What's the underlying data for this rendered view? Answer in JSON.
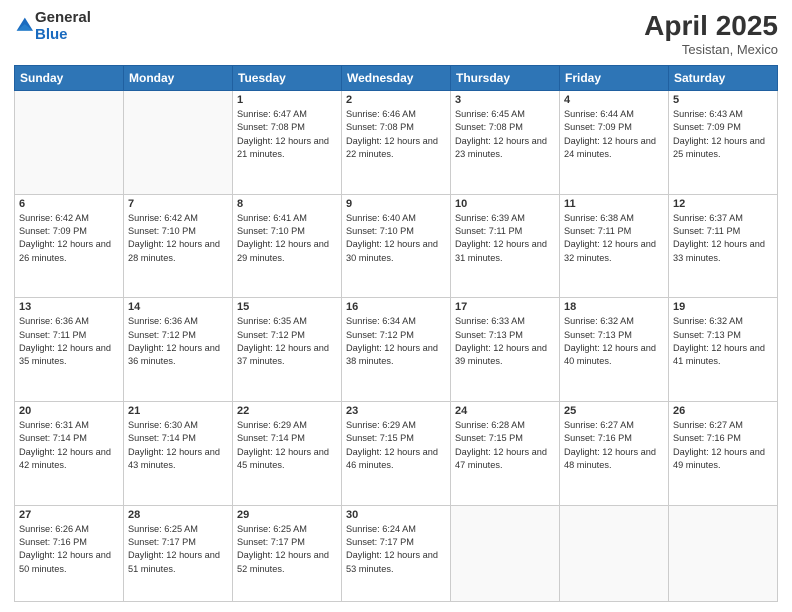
{
  "logo": {
    "line1": "General",
    "line2": "Blue"
  },
  "title": "April 2025",
  "subtitle": "Tesistan, Mexico",
  "days_header": [
    "Sunday",
    "Monday",
    "Tuesday",
    "Wednesday",
    "Thursday",
    "Friday",
    "Saturday"
  ],
  "weeks": [
    [
      {
        "day": "",
        "sunrise": "",
        "sunset": "",
        "daylight": ""
      },
      {
        "day": "",
        "sunrise": "",
        "sunset": "",
        "daylight": ""
      },
      {
        "day": "1",
        "sunrise": "Sunrise: 6:47 AM",
        "sunset": "Sunset: 7:08 PM",
        "daylight": "Daylight: 12 hours and 21 minutes."
      },
      {
        "day": "2",
        "sunrise": "Sunrise: 6:46 AM",
        "sunset": "Sunset: 7:08 PM",
        "daylight": "Daylight: 12 hours and 22 minutes."
      },
      {
        "day": "3",
        "sunrise": "Sunrise: 6:45 AM",
        "sunset": "Sunset: 7:08 PM",
        "daylight": "Daylight: 12 hours and 23 minutes."
      },
      {
        "day": "4",
        "sunrise": "Sunrise: 6:44 AM",
        "sunset": "Sunset: 7:09 PM",
        "daylight": "Daylight: 12 hours and 24 minutes."
      },
      {
        "day": "5",
        "sunrise": "Sunrise: 6:43 AM",
        "sunset": "Sunset: 7:09 PM",
        "daylight": "Daylight: 12 hours and 25 minutes."
      }
    ],
    [
      {
        "day": "6",
        "sunrise": "Sunrise: 6:42 AM",
        "sunset": "Sunset: 7:09 PM",
        "daylight": "Daylight: 12 hours and 26 minutes."
      },
      {
        "day": "7",
        "sunrise": "Sunrise: 6:42 AM",
        "sunset": "Sunset: 7:10 PM",
        "daylight": "Daylight: 12 hours and 28 minutes."
      },
      {
        "day": "8",
        "sunrise": "Sunrise: 6:41 AM",
        "sunset": "Sunset: 7:10 PM",
        "daylight": "Daylight: 12 hours and 29 minutes."
      },
      {
        "day": "9",
        "sunrise": "Sunrise: 6:40 AM",
        "sunset": "Sunset: 7:10 PM",
        "daylight": "Daylight: 12 hours and 30 minutes."
      },
      {
        "day": "10",
        "sunrise": "Sunrise: 6:39 AM",
        "sunset": "Sunset: 7:11 PM",
        "daylight": "Daylight: 12 hours and 31 minutes."
      },
      {
        "day": "11",
        "sunrise": "Sunrise: 6:38 AM",
        "sunset": "Sunset: 7:11 PM",
        "daylight": "Daylight: 12 hours and 32 minutes."
      },
      {
        "day": "12",
        "sunrise": "Sunrise: 6:37 AM",
        "sunset": "Sunset: 7:11 PM",
        "daylight": "Daylight: 12 hours and 33 minutes."
      }
    ],
    [
      {
        "day": "13",
        "sunrise": "Sunrise: 6:36 AM",
        "sunset": "Sunset: 7:11 PM",
        "daylight": "Daylight: 12 hours and 35 minutes."
      },
      {
        "day": "14",
        "sunrise": "Sunrise: 6:36 AM",
        "sunset": "Sunset: 7:12 PM",
        "daylight": "Daylight: 12 hours and 36 minutes."
      },
      {
        "day": "15",
        "sunrise": "Sunrise: 6:35 AM",
        "sunset": "Sunset: 7:12 PM",
        "daylight": "Daylight: 12 hours and 37 minutes."
      },
      {
        "day": "16",
        "sunrise": "Sunrise: 6:34 AM",
        "sunset": "Sunset: 7:12 PM",
        "daylight": "Daylight: 12 hours and 38 minutes."
      },
      {
        "day": "17",
        "sunrise": "Sunrise: 6:33 AM",
        "sunset": "Sunset: 7:13 PM",
        "daylight": "Daylight: 12 hours and 39 minutes."
      },
      {
        "day": "18",
        "sunrise": "Sunrise: 6:32 AM",
        "sunset": "Sunset: 7:13 PM",
        "daylight": "Daylight: 12 hours and 40 minutes."
      },
      {
        "day": "19",
        "sunrise": "Sunrise: 6:32 AM",
        "sunset": "Sunset: 7:13 PM",
        "daylight": "Daylight: 12 hours and 41 minutes."
      }
    ],
    [
      {
        "day": "20",
        "sunrise": "Sunrise: 6:31 AM",
        "sunset": "Sunset: 7:14 PM",
        "daylight": "Daylight: 12 hours and 42 minutes."
      },
      {
        "day": "21",
        "sunrise": "Sunrise: 6:30 AM",
        "sunset": "Sunset: 7:14 PM",
        "daylight": "Daylight: 12 hours and 43 minutes."
      },
      {
        "day": "22",
        "sunrise": "Sunrise: 6:29 AM",
        "sunset": "Sunset: 7:14 PM",
        "daylight": "Daylight: 12 hours and 45 minutes."
      },
      {
        "day": "23",
        "sunrise": "Sunrise: 6:29 AM",
        "sunset": "Sunset: 7:15 PM",
        "daylight": "Daylight: 12 hours and 46 minutes."
      },
      {
        "day": "24",
        "sunrise": "Sunrise: 6:28 AM",
        "sunset": "Sunset: 7:15 PM",
        "daylight": "Daylight: 12 hours and 47 minutes."
      },
      {
        "day": "25",
        "sunrise": "Sunrise: 6:27 AM",
        "sunset": "Sunset: 7:16 PM",
        "daylight": "Daylight: 12 hours and 48 minutes."
      },
      {
        "day": "26",
        "sunrise": "Sunrise: 6:27 AM",
        "sunset": "Sunset: 7:16 PM",
        "daylight": "Daylight: 12 hours and 49 minutes."
      }
    ],
    [
      {
        "day": "27",
        "sunrise": "Sunrise: 6:26 AM",
        "sunset": "Sunset: 7:16 PM",
        "daylight": "Daylight: 12 hours and 50 minutes."
      },
      {
        "day": "28",
        "sunrise": "Sunrise: 6:25 AM",
        "sunset": "Sunset: 7:17 PM",
        "daylight": "Daylight: 12 hours and 51 minutes."
      },
      {
        "day": "29",
        "sunrise": "Sunrise: 6:25 AM",
        "sunset": "Sunset: 7:17 PM",
        "daylight": "Daylight: 12 hours and 52 minutes."
      },
      {
        "day": "30",
        "sunrise": "Sunrise: 6:24 AM",
        "sunset": "Sunset: 7:17 PM",
        "daylight": "Daylight: 12 hours and 53 minutes."
      },
      {
        "day": "",
        "sunrise": "",
        "sunset": "",
        "daylight": ""
      },
      {
        "day": "",
        "sunrise": "",
        "sunset": "",
        "daylight": ""
      },
      {
        "day": "",
        "sunrise": "",
        "sunset": "",
        "daylight": ""
      }
    ]
  ]
}
